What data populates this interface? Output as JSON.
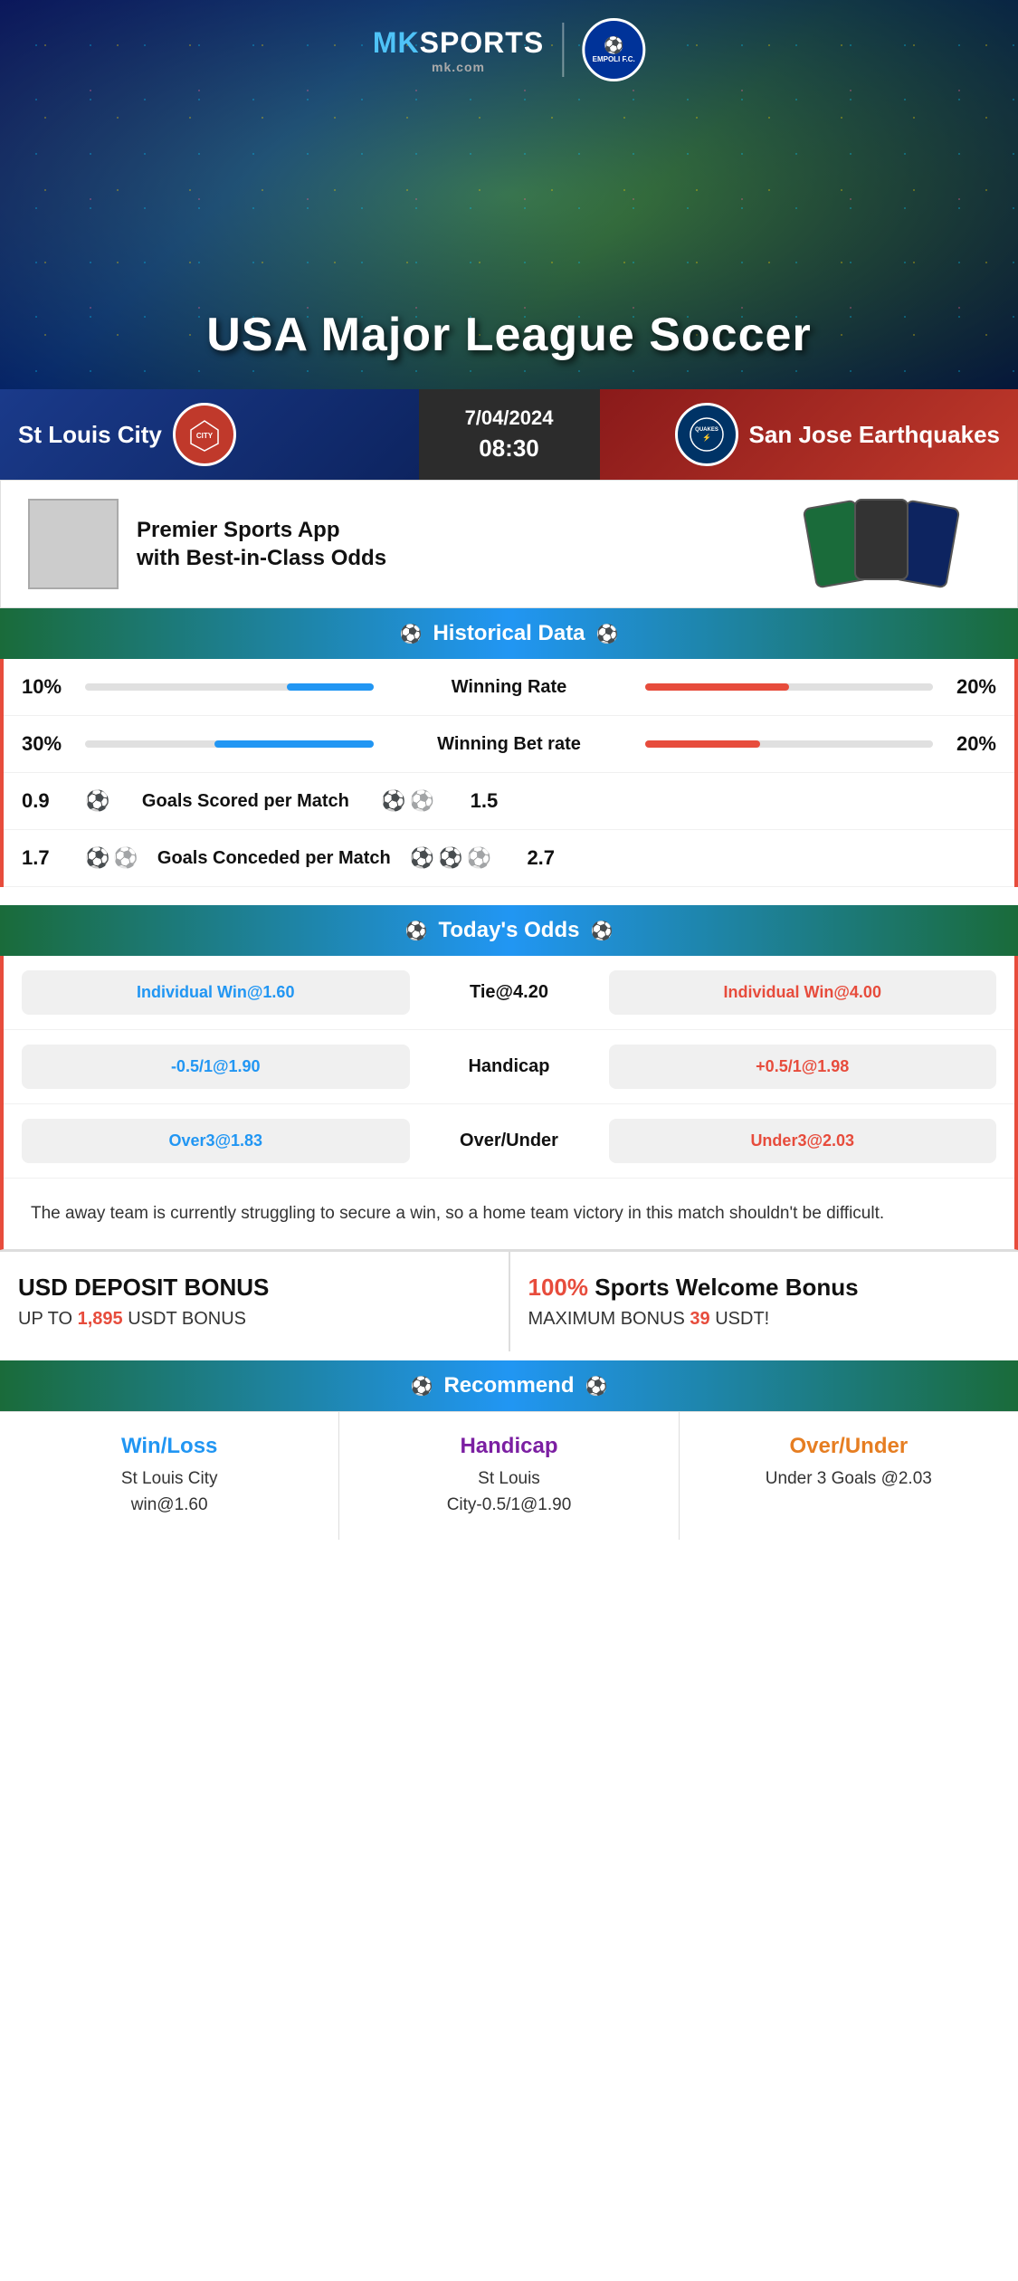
{
  "brand": {
    "name": "MK SPORTS",
    "mk": "MK",
    "sports": "SPORTS",
    "url": "mk.com",
    "partner": "EMPOLI F.C."
  },
  "hero": {
    "title": "USA Major League Soccer"
  },
  "match": {
    "home_team": "St Louis City",
    "away_team": "San Jose Earthquakes",
    "away_team_short": "QUAKES San Jose Earthquakes",
    "date": "7/04/2024",
    "time": "08:30"
  },
  "app_promo": {
    "text": "Premier Sports App\nwith Best-in-Class Odds"
  },
  "historical": {
    "header": "Historical Data",
    "rows": [
      {
        "label": "Winning Rate",
        "left_val": "10%",
        "right_val": "20%",
        "left_pct": 30,
        "right_pct": 50
      },
      {
        "label": "Winning Bet rate",
        "left_val": "30%",
        "right_val": "20%",
        "left_pct": 55,
        "right_pct": 40
      },
      {
        "label": "Goals Scored per Match",
        "left_val": "0.9",
        "right_val": "1.5",
        "left_icons": 1,
        "right_icons": 2
      },
      {
        "label": "Goals Conceded per Match",
        "left_val": "1.7",
        "right_val": "2.7",
        "left_icons": 2,
        "right_icons": 3
      }
    ]
  },
  "odds": {
    "header": "Today's Odds",
    "rows": [
      {
        "left": "Individual Win@1.60",
        "center": "Tie@4.20",
        "right": "Individual Win@4.00",
        "left_color": "blue",
        "right_color": "red"
      },
      {
        "left": "-0.5/1@1.90",
        "center": "Handicap",
        "right": "+0.5/1@1.98",
        "left_color": "blue",
        "right_color": "red"
      },
      {
        "left": "Over3@1.83",
        "center": "Over/Under",
        "right": "Under3@2.03",
        "left_color": "blue",
        "right_color": "red"
      }
    ]
  },
  "analysis": {
    "text": "The away team is currently struggling to secure a win, so a home team victory in this match shouldn't be difficult."
  },
  "bonus": {
    "left_title": "USD DEPOSIT BONUS",
    "left_sub": "UP TO",
    "left_amount": "1,895",
    "left_suffix": "USDT BONUS",
    "right_prefix": "100%",
    "right_title": "Sports Welcome Bonus",
    "right_sub": "MAXIMUM BONUS",
    "right_amount": "39",
    "right_suffix": "USDT!"
  },
  "recommend": {
    "header": "Recommend",
    "items": [
      {
        "type": "Win/Loss",
        "color": "blue",
        "pick": "St Louis City\nwin@1.60"
      },
      {
        "type": "Handicap",
        "color": "purple",
        "pick": "St Louis\nCity-0.5/1@1.90"
      },
      {
        "type": "Over/Under",
        "color": "orange",
        "pick": "Under 3 Goals @2.03"
      }
    ]
  }
}
